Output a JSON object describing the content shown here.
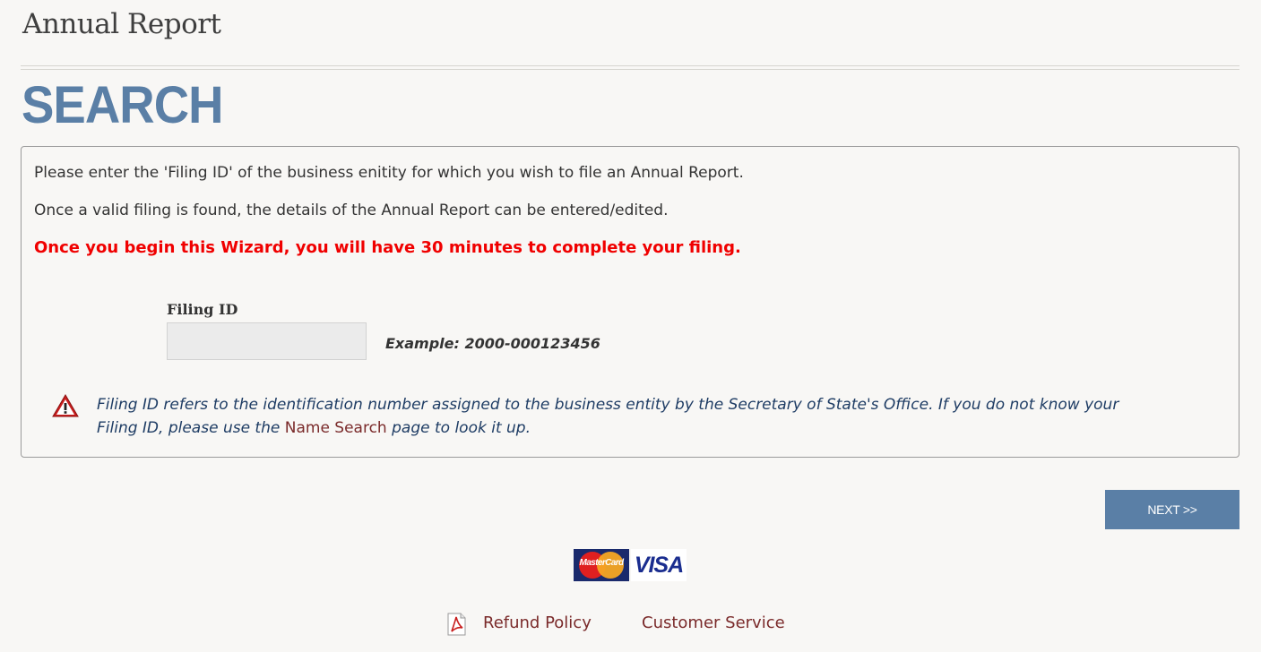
{
  "header": {
    "title": "Annual Report"
  },
  "section": {
    "title": "SEARCH"
  },
  "instructions": {
    "line1": "Please enter the 'Filing ID' of the business enitity for which you wish to file an Annual Report.",
    "line2": "Once a valid filing is found, the details of the Annual Report can be entered/edited.",
    "warning": "Once you begin this Wizard, you will have 30 minutes to complete your filing."
  },
  "filing_id": {
    "label": "Filing ID",
    "value": "",
    "placeholder": "",
    "example": "Example: 2000-000123456"
  },
  "note": {
    "text_before": "Filing ID refers to the identification number assigned to the business entity by the Secretary of State's Office. If you do not know your Filing ID, please use the ",
    "link_label": "Name Search",
    "text_after": " page to look it up.",
    "icon": "warning-triangle-icon"
  },
  "actions": {
    "next_label": "NEXT >>"
  },
  "payment": {
    "mastercard_label": "MasterCard",
    "visa_label": "VISA"
  },
  "footer": {
    "refund_label": "Refund Policy",
    "customer_service_label": "Customer Service"
  },
  "colors": {
    "accent": "#5a7fa6",
    "warning_text": "#f00000",
    "link": "#7a2a2a",
    "note_text": "#1e3c64",
    "background": "#f8f7f5"
  }
}
